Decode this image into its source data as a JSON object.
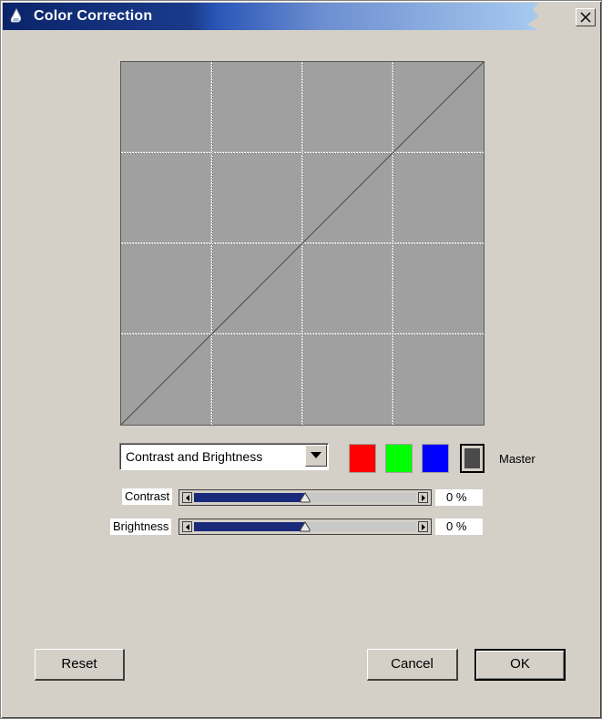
{
  "window": {
    "title": "Color Correction",
    "icons": {
      "app": "color-correction-app-icon",
      "close": "close-icon"
    }
  },
  "curve": {
    "grid_divisions": 4,
    "line": "identity-diagonal"
  },
  "controls": {
    "mode_select": {
      "value": "Contrast and Brightness",
      "icon": "chevron-down-icon"
    },
    "channels": [
      {
        "name": "red",
        "color": "#ff0000"
      },
      {
        "name": "green",
        "color": "#00ff00"
      },
      {
        "name": "blue",
        "color": "#0000ff"
      },
      {
        "name": "master",
        "color": "#4a4a4a"
      }
    ],
    "master_label": "Master",
    "contrast": {
      "label": "Contrast",
      "value": "0 %",
      "level": 0.5
    },
    "brightness": {
      "label": "Brightness",
      "value": "0 %",
      "level": 0.5
    }
  },
  "buttons": {
    "reset": "Reset",
    "cancel": "Cancel",
    "ok": "OK"
  }
}
